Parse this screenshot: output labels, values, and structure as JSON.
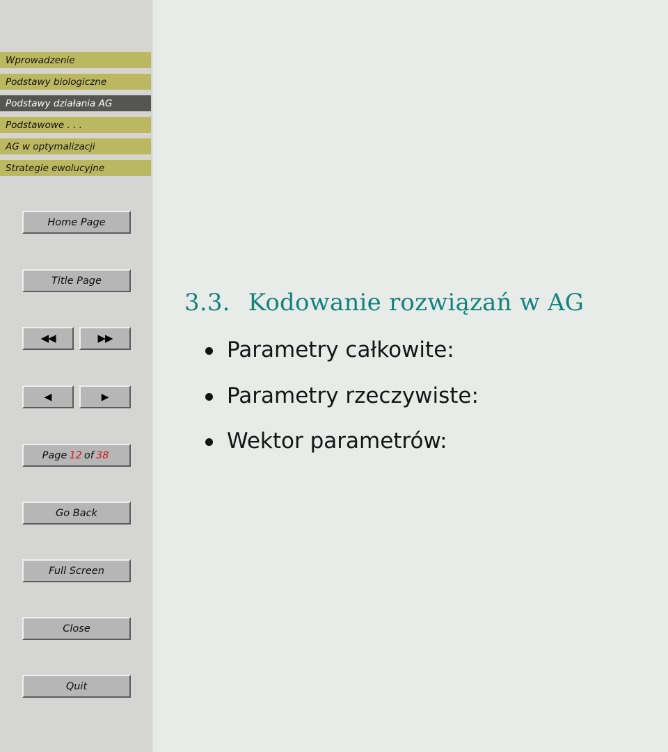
{
  "slide": {
    "title_number": "3.3.",
    "title_text": "Kodowanie rozwiązań w AG",
    "bullets": [
      {
        "text": "Parametry całkowite:"
      },
      {
        "text": "Parametry rzeczywiste:"
      },
      {
        "text": "Wektor parametrów:"
      }
    ]
  },
  "sidebar": {
    "nav_items": [
      {
        "label": "Wprowadzenie",
        "selected": false
      },
      {
        "label": "Podstawy biologiczne",
        "selected": false
      },
      {
        "label": "Podstawy działania AG",
        "selected": true
      },
      {
        "label": "Podstawowe . . .",
        "selected": false
      },
      {
        "label": "AG w optymalizacji",
        "selected": false
      },
      {
        "label": "Strategie ewolucyjne",
        "selected": false
      }
    ],
    "buttons": {
      "home_page": "Home Page",
      "title_page": "Title Page",
      "fast_back_icon": "double-left-arrow-icon",
      "fast_back_glyph": "◀◀",
      "fast_forward_icon": "double-right-arrow-icon",
      "fast_forward_glyph": "▶▶",
      "prev_icon": "left-arrow-icon",
      "prev_glyph": "◀",
      "next_icon": "right-arrow-icon",
      "next_glyph": "▶",
      "go_back": "Go Back",
      "full_screen": "Full Screen",
      "close": "Close",
      "quit": "Quit"
    },
    "page_counter": {
      "prefix": "Page",
      "current": "12",
      "middle": "of",
      "total": "38"
    }
  },
  "colors": {
    "nav_background": "#bcb862",
    "nav_selected_background": "#555554",
    "sidebar_background": "#d5d5d3",
    "content_background": "#e7ece9",
    "title_accent": "#14817d",
    "counter_accent": "#d01818",
    "button_face": "#b6b6b6"
  }
}
